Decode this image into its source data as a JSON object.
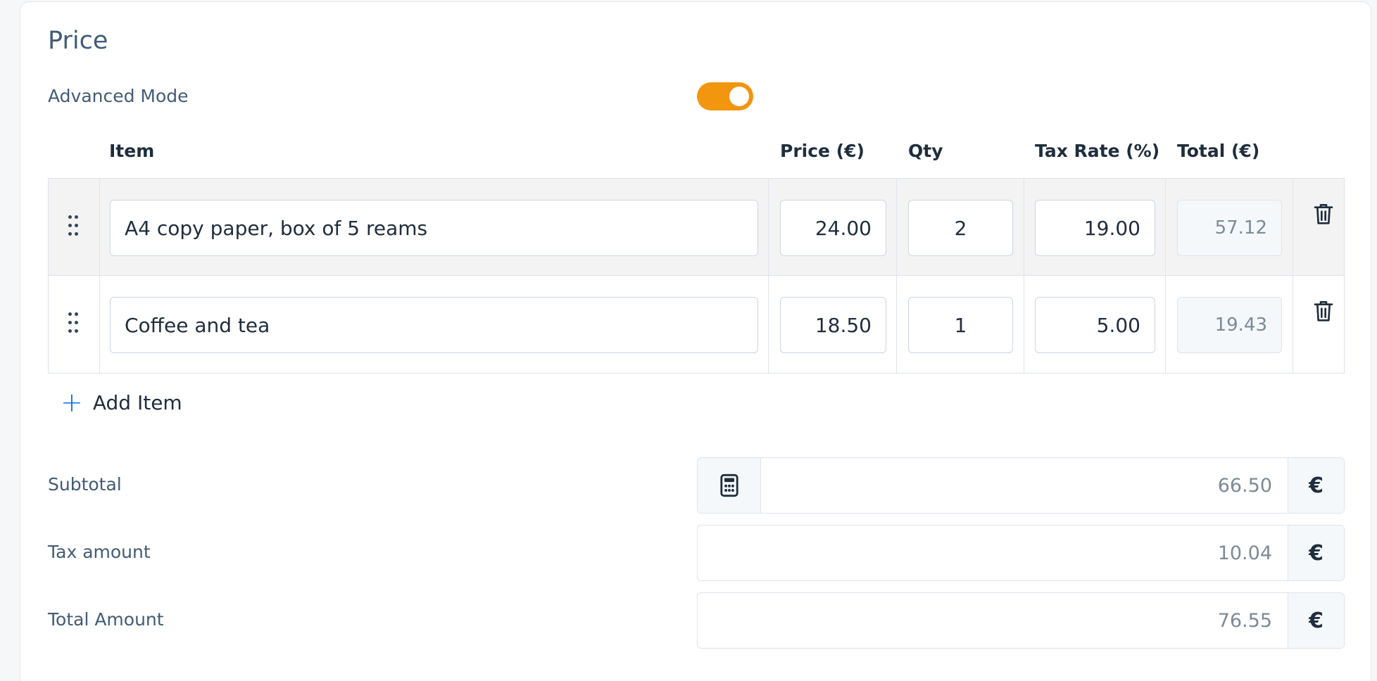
{
  "section": {
    "title": "Price",
    "advanced_mode": {
      "label": "Advanced Mode",
      "enabled": true
    }
  },
  "table": {
    "headers": {
      "item": "Item",
      "price": "Price (€)",
      "qty": "Qty",
      "tax_rate": "Tax Rate (%)",
      "total": "Total (€)"
    },
    "rows": [
      {
        "item": "A4 copy paper, box of 5 reams",
        "price": "24.00",
        "qty": "2",
        "tax_rate": "19.00",
        "total": "57.12"
      },
      {
        "item": "Coffee and tea",
        "price": "18.50",
        "qty": "1",
        "tax_rate": "5.00",
        "total": "19.43"
      }
    ],
    "add_item_label": "Add Item"
  },
  "summary": {
    "subtotal": {
      "label": "Subtotal",
      "value": "66.50",
      "currency": "€"
    },
    "tax": {
      "label": "Tax amount",
      "value": "10.04",
      "currency": "€"
    },
    "total": {
      "label": "Total Amount",
      "value": "76.55",
      "currency": "€"
    }
  },
  "icons": {
    "drag": "drag-handle-icon",
    "delete": "trash-icon",
    "add": "plus-icon",
    "calc": "calculator-icon"
  },
  "colors": {
    "accent": "#f2950f",
    "link": "#0a72e8",
    "label": "#425b76",
    "text": "#1f2d3d"
  }
}
